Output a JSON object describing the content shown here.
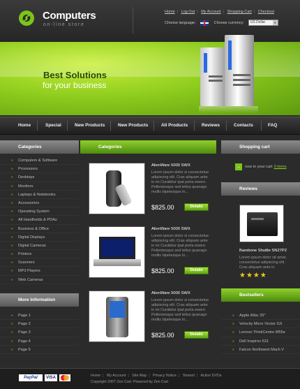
{
  "header": {
    "title": "Computers",
    "subtitle": "on-line store",
    "top_links": [
      "Home",
      "Log Out",
      "My Account",
      "Shopping Cart",
      "Checkout"
    ],
    "choose_language": "Choose language:",
    "choose_currency": "Choose currency:",
    "currency_value": "US Dollar"
  },
  "banner": {
    "headline": "Best Solutions",
    "tagline": "for your business"
  },
  "nav": [
    "Home",
    "Special",
    "New Products",
    "New Products",
    "All Products",
    "Reviews",
    "Contacts",
    "FAQ"
  ],
  "left": {
    "categories_title": "Categories",
    "categories": [
      "Computers & Software",
      "Processors",
      "Desktops",
      "Monitors",
      "Laptops & Notebooks",
      "Accessories",
      "Operating System",
      "All Handhelds & PDAs",
      "Business & Office",
      "Digital Displays",
      "Digital Cameras",
      "Printers",
      "Scanners",
      "MP3 Players",
      "Web Cameras"
    ],
    "more_title": "More Information",
    "more_items": [
      "Page 1",
      "Page 2",
      "Page 3",
      "Page 4",
      "Page 5"
    ]
  },
  "center": {
    "title": "Categories",
    "details_label": "Details",
    "products": [
      {
        "name": "AlienWare 5000 SWX",
        "desc": "Lorem ipsum dolor si consectetue adipiscing elit. Cras aliquam ante in mi Curabitur tpat porta ewere. Pellentesque sed tellus quanagn mollis bipetesque in...",
        "price": "$825.00",
        "icon": "mobile-phone-icon"
      },
      {
        "name": "AlienWare 5000 SWX",
        "desc": "Lorem ipsum dolor si consectetue adipiscing elit. Cras aliquam ante in mi Curabitur tpat porta ewere. Pellentesque sed tellus quanagn mollis bipetesque in...",
        "price": "$825.00",
        "icon": "laptop-icon"
      },
      {
        "name": "AlienWare 5000 SWX",
        "desc": "Lorem ipsum dolor si consectetue adipiscing elit. Cras aliquam ante in mi Curabitur tpat porta ewere. Pellentesque sed tellus quanagn mollis bipetesque in...",
        "price": "$825.00",
        "icon": "pda-icon"
      }
    ]
  },
  "right": {
    "cart_title": "Shopping cart",
    "cart_text": "now in your cart",
    "cart_items": "3 items",
    "reviews_title": "Reviews",
    "review_name": "Barebone Shuttle SN27P2",
    "review_desc": "Lorem ipsum dolor sit amet, consectetue adipiscing elit. Cras aliquam ante in",
    "rating": 4,
    "bestsellers_title": "Bestsellers",
    "bestsellers": [
      "Apple iMac 20\"",
      "Velocity Micro Vector GX",
      "Lenovo ThinkCentre M55e",
      "Dell Inspiron 531",
      "Falcon Northwest Mach V"
    ]
  },
  "footer": {
    "payment": [
      "PayPal",
      "VISA",
      "MasterCard"
    ],
    "links": [
      "Home",
      "My Account",
      "Site Map",
      "Privacy Notice",
      "Shared",
      "Action DVDs"
    ],
    "copyright": "Copyright  2007 Zen Cart. Powered by Zen Cart"
  },
  "colors": {
    "accent_green": "#8fd02a",
    "background": "#2b2b2b",
    "star": "#f4c81a"
  }
}
